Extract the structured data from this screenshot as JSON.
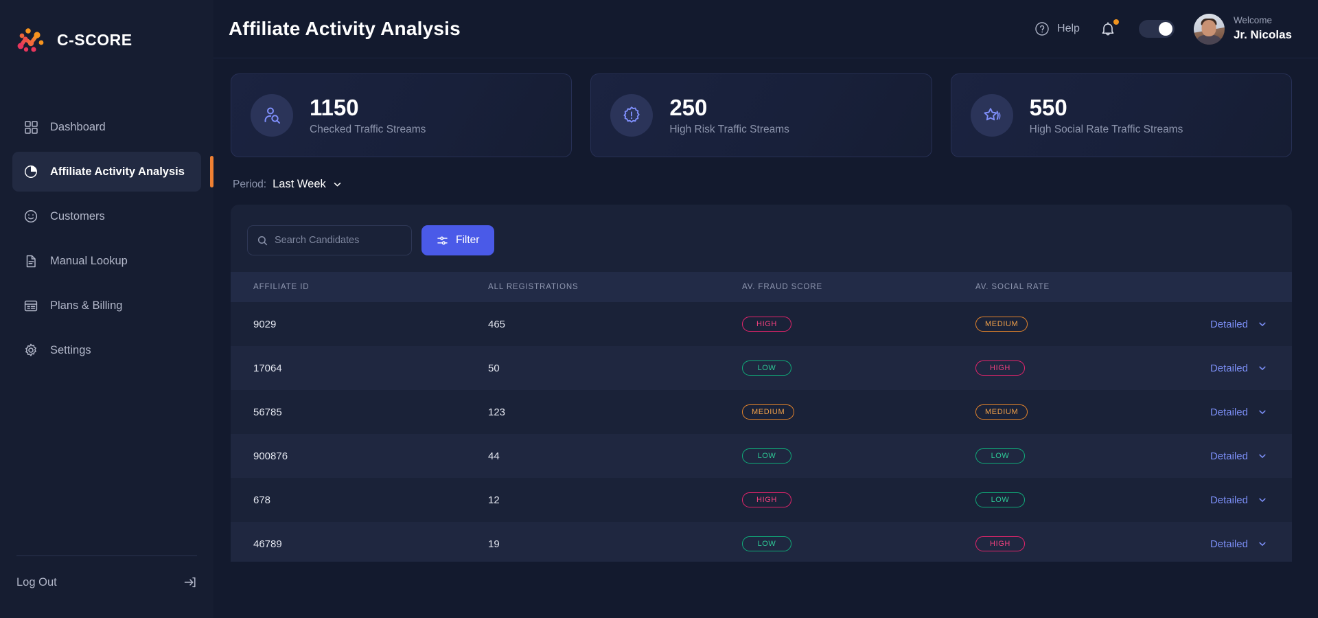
{
  "brand": {
    "name": "C-SCORE",
    "logo_icon": "cscore-logo-icon",
    "accent": "#ef8033"
  },
  "sidebar": {
    "items": [
      {
        "label": "Dashboard",
        "icon": "grid-icon",
        "active": false
      },
      {
        "label": "Affiliate Activity Analysis",
        "icon": "pie-chart-icon",
        "active": true
      },
      {
        "label": "Customers",
        "icon": "smiley-icon",
        "active": false
      },
      {
        "label": "Manual Lookup",
        "icon": "document-icon",
        "active": false
      },
      {
        "label": "Plans & Billing",
        "icon": "billing-icon",
        "active": false
      },
      {
        "label": "Settings",
        "icon": "gear-icon",
        "active": false
      }
    ],
    "logout": {
      "label": "Log Out",
      "icon": "logout-icon"
    }
  },
  "header": {
    "title": "Affiliate Activity Analysis",
    "help_label": "Help",
    "help_icon": "question-circle-icon",
    "bell_icon": "bell-icon",
    "notification_dot_color": "#f0941f",
    "theme_toggle": {
      "icon": "toggle-switch",
      "state": "on"
    },
    "user": {
      "welcome": "Welcome",
      "name": "Jr. Nicolas",
      "avatar": "user-avatar"
    }
  },
  "stats": [
    {
      "value": "1150",
      "label": "Checked Traffic Streams",
      "icon": "person-search-icon"
    },
    {
      "value": "250",
      "label": "High Risk Traffic Streams",
      "icon": "alert-badge-icon"
    },
    {
      "value": "550",
      "label": "High Social Rate Traffic Streams",
      "icon": "star-icon"
    }
  ],
  "period": {
    "label": "Period:",
    "value": "Last Week",
    "caret_icon": "chevron-down-icon"
  },
  "toolbar": {
    "search_placeholder": "Search Candidates",
    "search_value": "",
    "search_icon": "search-icon",
    "filter_label": "Filter",
    "filter_icon": "sliders-icon",
    "filter_color": "#4a5ae8"
  },
  "table": {
    "columns": [
      "AFFILIATE ID",
      "ALL REGISTRATIONS",
      "AV. FRAUD SCORE",
      "AV. SOCIAL RATE"
    ],
    "action_label": "Detailed",
    "action_icon": "chevron-down-icon",
    "badge_colors": {
      "high": "#e8246c",
      "medium": "#e8862b",
      "low": "#0fae7a"
    },
    "rows": [
      {
        "id": "9029",
        "registrations": "465",
        "fraud": "HIGH",
        "social": "MEDIUM"
      },
      {
        "id": "17064",
        "registrations": "50",
        "fraud": "LOW",
        "social": "HIGH"
      },
      {
        "id": "56785",
        "registrations": "123",
        "fraud": "MEDIUM",
        "social": "MEDIUM"
      },
      {
        "id": "900876",
        "registrations": "44",
        "fraud": "LOW",
        "social": "LOW"
      },
      {
        "id": "678",
        "registrations": "12",
        "fraud": "HIGH",
        "social": "LOW"
      },
      {
        "id": "46789",
        "registrations": "19",
        "fraud": "LOW",
        "social": "HIGH"
      }
    ]
  }
}
